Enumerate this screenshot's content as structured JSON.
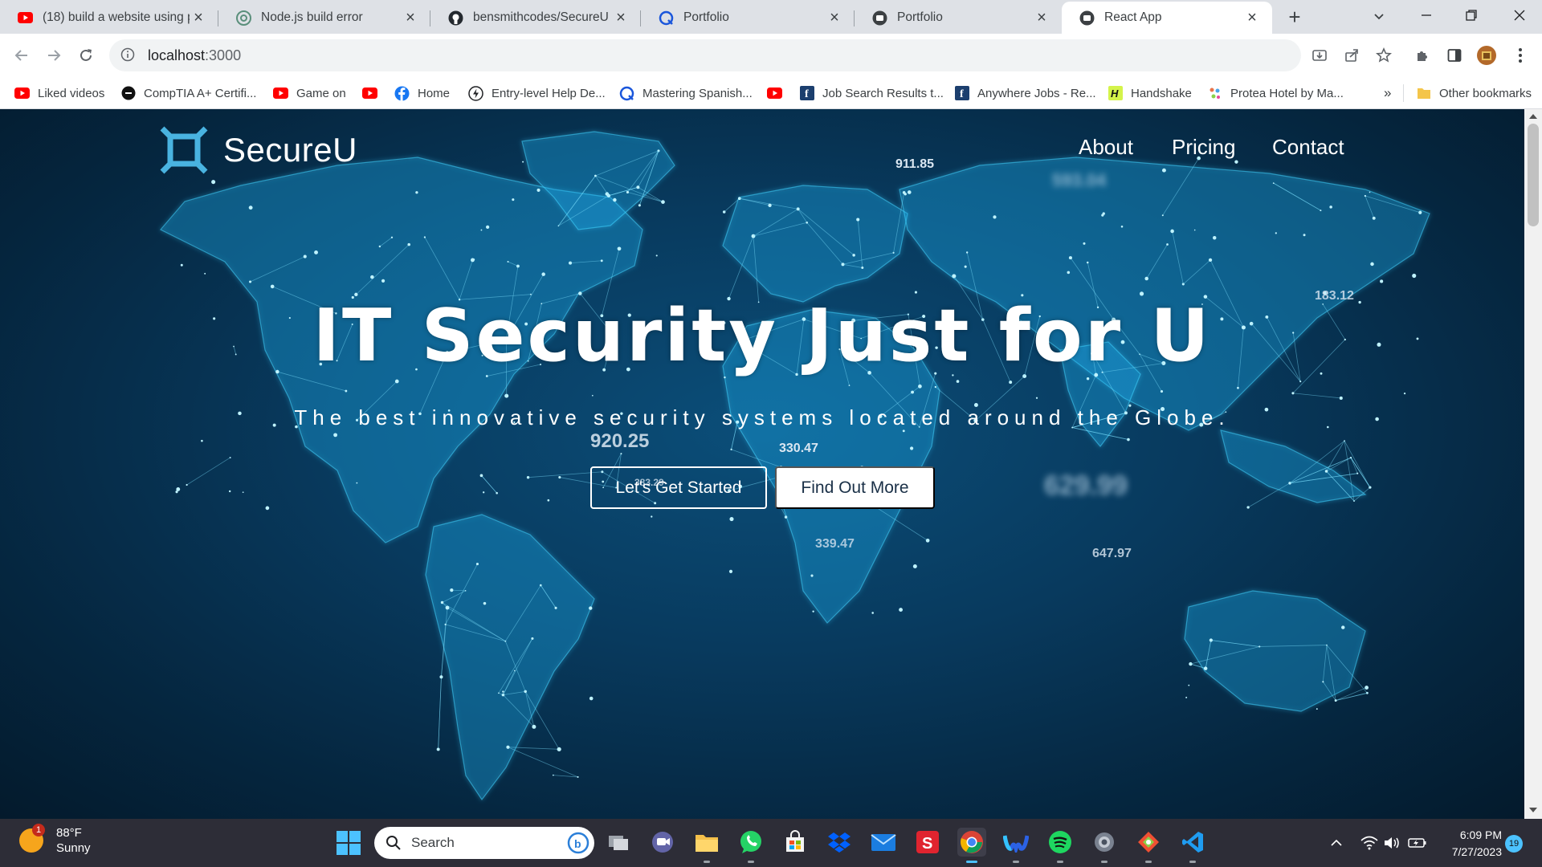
{
  "browser": {
    "tabs": [
      {
        "title": "(18) build a website using p",
        "icon": "youtube-icon",
        "active": false
      },
      {
        "title": "Node.js build error",
        "icon": "chatgpt-icon",
        "active": false
      },
      {
        "title": "bensmithcodes/SecureU",
        "icon": "github-icon",
        "active": false
      },
      {
        "title": "Portfolio",
        "icon": "portfolio-q-icon",
        "active": false
      },
      {
        "title": "Portfolio",
        "icon": "react-app-icon",
        "active": false
      },
      {
        "title": "React App",
        "icon": "react-app-icon",
        "active": true
      }
    ],
    "url_host": "localhost",
    "url_port": ":3000",
    "bookmarks": [
      {
        "label": "Liked videos",
        "icon": "youtube-icon"
      },
      {
        "label": "CompTIA A+ Certifi...",
        "icon": "comptia-icon"
      },
      {
        "label": "Game on",
        "icon": "youtube-icon"
      },
      {
        "label": "",
        "icon": "youtube-icon"
      },
      {
        "label": "Home",
        "icon": "facebook-icon"
      },
      {
        "label": "Entry-level Help De...",
        "icon": "bolt-icon"
      },
      {
        "label": "Mastering Spanish...",
        "icon": "q-icon"
      },
      {
        "label": "",
        "icon": "youtube-icon"
      },
      {
        "label": "Job Search Results t...",
        "icon": "f-icon"
      },
      {
        "label": "Anywhere Jobs - Re...",
        "icon": "f-icon"
      },
      {
        "label": "Handshake",
        "icon": "handshake-icon"
      },
      {
        "label": "Protea Hotel by Ma...",
        "icon": "protea-icon"
      }
    ],
    "more_bookmarks": "»",
    "other_bookmarks": "Other bookmarks"
  },
  "site": {
    "brand": "SecureU",
    "menu": [
      "About",
      "Pricing",
      "Contact"
    ],
    "hero_title": "IT Security Just for U",
    "hero_subtitle": "The best innovative security systems located around the Globe.",
    "cta_primary": "Let's Get Started",
    "cta_secondary": "Find Out More",
    "background_numbers": [
      "911.85",
      "593.04",
      "183.12",
      "920.25",
      "330.47",
      "383.29",
      "629.99",
      "339.47",
      "647.97"
    ]
  },
  "taskbar": {
    "weather_temp": "88°F",
    "weather_desc": "Sunny",
    "weather_badge": "1",
    "search_label": "Search",
    "time": "6:09 PM",
    "date": "7/27/2023",
    "notification_count": "19"
  },
  "colors": {
    "hero_bg": "#083a5e",
    "accent_cyan": "#3fd3ff",
    "taskbar_bg": "#2d2d37"
  }
}
